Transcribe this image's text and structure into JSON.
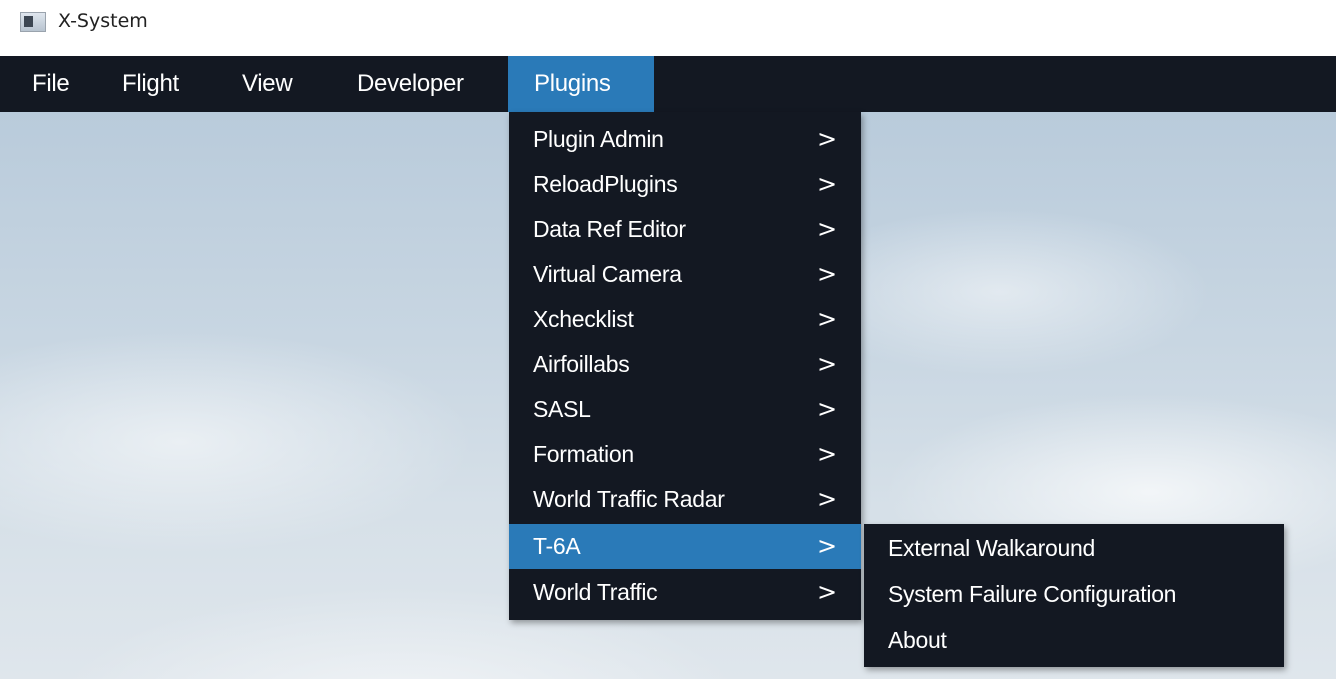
{
  "window": {
    "title": "X-System"
  },
  "menubar": {
    "items": [
      "File",
      "Flight",
      "View",
      "Developer",
      "Plugins"
    ],
    "active": "Plugins"
  },
  "plugins_menu": {
    "items": [
      "Plugin Admin",
      "ReloadPlugins",
      "Data Ref Editor",
      "Virtual Camera",
      "Xchecklist",
      "Airfoillabs",
      "SASL",
      "Formation",
      "World Traffic Radar",
      "T-6A",
      "World Traffic"
    ],
    "active": "T-6A",
    "submenu_indicator": ">"
  },
  "t6a_submenu": {
    "items": [
      "External Walkaround",
      "System Failure Configuration",
      "About"
    ]
  },
  "colors": {
    "menu_bg": "#131822",
    "highlight": "#2a7ab8",
    "text": "#ffffff"
  }
}
